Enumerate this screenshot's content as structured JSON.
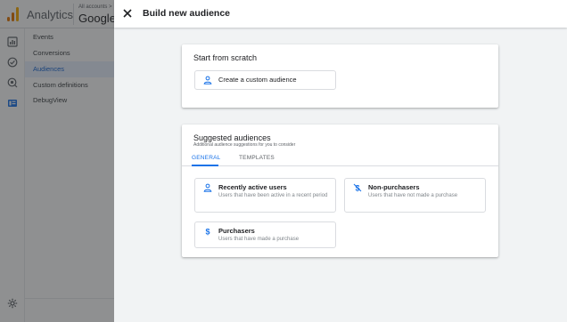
{
  "app": {
    "name": "Analytics",
    "account_breadcrumb": "All accounts >",
    "property_name": "Google"
  },
  "nav": {
    "items": [
      {
        "label": "Events"
      },
      {
        "label": "Conversions"
      },
      {
        "label": "Audiences",
        "active": true
      },
      {
        "label": "Custom definitions"
      },
      {
        "label": "DebugView"
      }
    ]
  },
  "rail": {
    "icons": [
      "reports-icon",
      "explore-icon",
      "advertising-icon",
      "configure-icon",
      "admin-gear-icon"
    ]
  },
  "panel": {
    "title": "Build new audience",
    "scratch": {
      "title": "Start from scratch",
      "custom_label": "Create a custom audience"
    },
    "suggested": {
      "title": "Suggested audiences",
      "subtitle": "Additional audience suggestions for you to consider",
      "tabs": [
        "GENERAL",
        "TEMPLATES"
      ],
      "active_tab": "GENERAL",
      "items": [
        {
          "title": "Recently active users",
          "description": "Users that have been active in a recent period",
          "icon": "person-icon"
        },
        {
          "title": "Non-purchasers",
          "description": "Users that have not made a purchase",
          "icon": "no-dollar-icon"
        },
        {
          "title": "Purchasers",
          "description": "Users that have made a purchase",
          "icon": "dollar-icon"
        }
      ]
    }
  },
  "colors": {
    "accent": "#1a73e8",
    "scrim": "#202124",
    "panel_bg": "#f1f3f4"
  }
}
